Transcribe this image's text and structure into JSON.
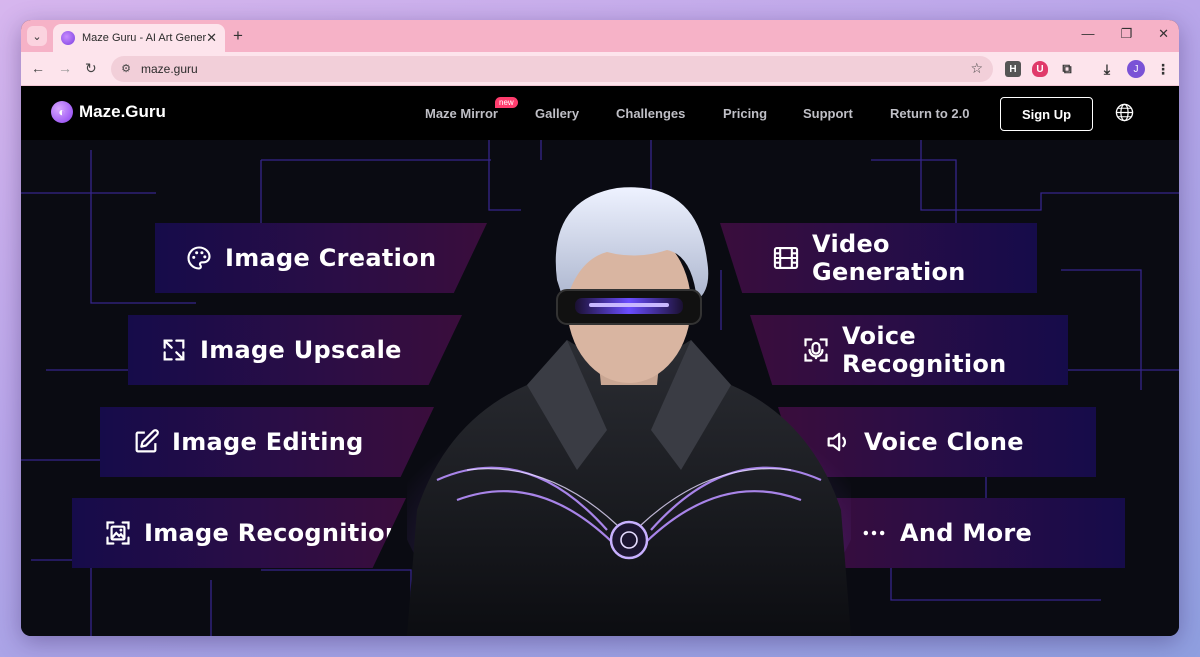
{
  "browser": {
    "tab_title": "Maze Guru - AI Art Generator -",
    "url": "maze.guru",
    "profile_initial": "J",
    "ext_h_label": "H"
  },
  "site": {
    "logo_text": "Maze.Guru",
    "nav": [
      {
        "label": "Maze Mirror",
        "badge": "new"
      },
      {
        "label": "Gallery"
      },
      {
        "label": "Challenges"
      },
      {
        "label": "Pricing"
      },
      {
        "label": "Support"
      },
      {
        "label": "Return to 2.0"
      }
    ],
    "signup_label": "Sign Up"
  },
  "features": {
    "left": [
      {
        "label": "Image Creation",
        "icon": "palette-icon"
      },
      {
        "label": "Image Upscale",
        "icon": "expand-icon"
      },
      {
        "label": "Image Editing",
        "icon": "edit-icon"
      },
      {
        "label": "Image Recognition",
        "icon": "image-scan-icon"
      }
    ],
    "right": [
      {
        "label": "Video Generation",
        "icon": "film-icon"
      },
      {
        "label": "Voice Recognition",
        "icon": "voice-scan-icon"
      },
      {
        "label": "Voice Clone",
        "icon": "speaker-icon"
      },
      {
        "label": "And More",
        "icon": "more-icon"
      }
    ]
  },
  "colors": {
    "accent": "#8a3ff0",
    "badge": "#ff3d6e",
    "circuit_line": "#4b2fb0"
  }
}
